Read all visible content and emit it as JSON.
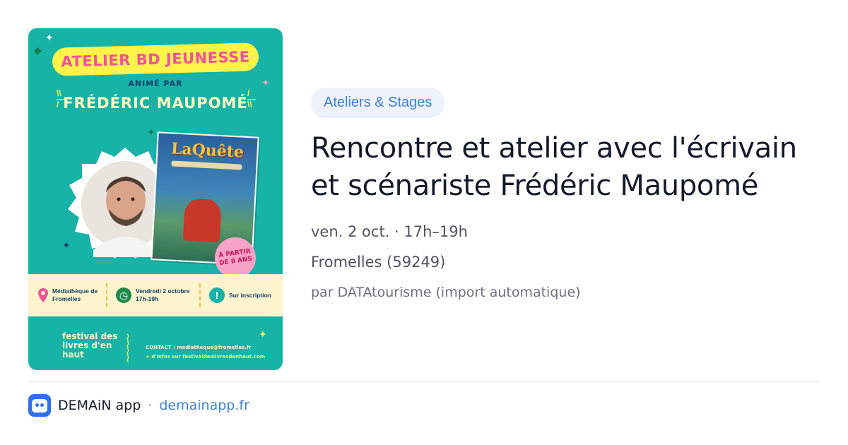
{
  "poster": {
    "banner": "ATELIER BD JEUNESSE",
    "subtitle": "ANIMÉ PAR",
    "name": "FRÉDÉRIC MAUPOMÉ",
    "book_title": "LaQuête",
    "age_badge": "À PARTIR DE 8 ANS",
    "location": "Médiathèque de Fromelles",
    "datetime_line1": "Vendredi 2 octobre",
    "datetime_line2": "17h-19h",
    "registration": "Sur inscription",
    "festival": "festival des livres d'en haut",
    "contact": "CONTACT : mediatheque@fromelles.fr",
    "more_info": "+ d'infos sur festivaldeslivresdenhaut.com",
    "colors": {
      "background": "#17b3a6",
      "banner": "#fff34a",
      "accent_pink": "#f0519c"
    }
  },
  "event": {
    "category": "Ateliers & Stages",
    "title": "Rencontre et atelier avec l'écrivain et scénariste Frédéric Maupomé",
    "date": "ven. 2 oct. · 17h–19h",
    "place": "Fromelles (59249)",
    "source": "par DATAtourisme (import automatique)"
  },
  "footer": {
    "app_name": "DEMAiN app",
    "separator": "·",
    "link": "demainapp.fr",
    "colors": {
      "link": "#3f7fd6",
      "app_icon": "#2f6fe8"
    }
  }
}
